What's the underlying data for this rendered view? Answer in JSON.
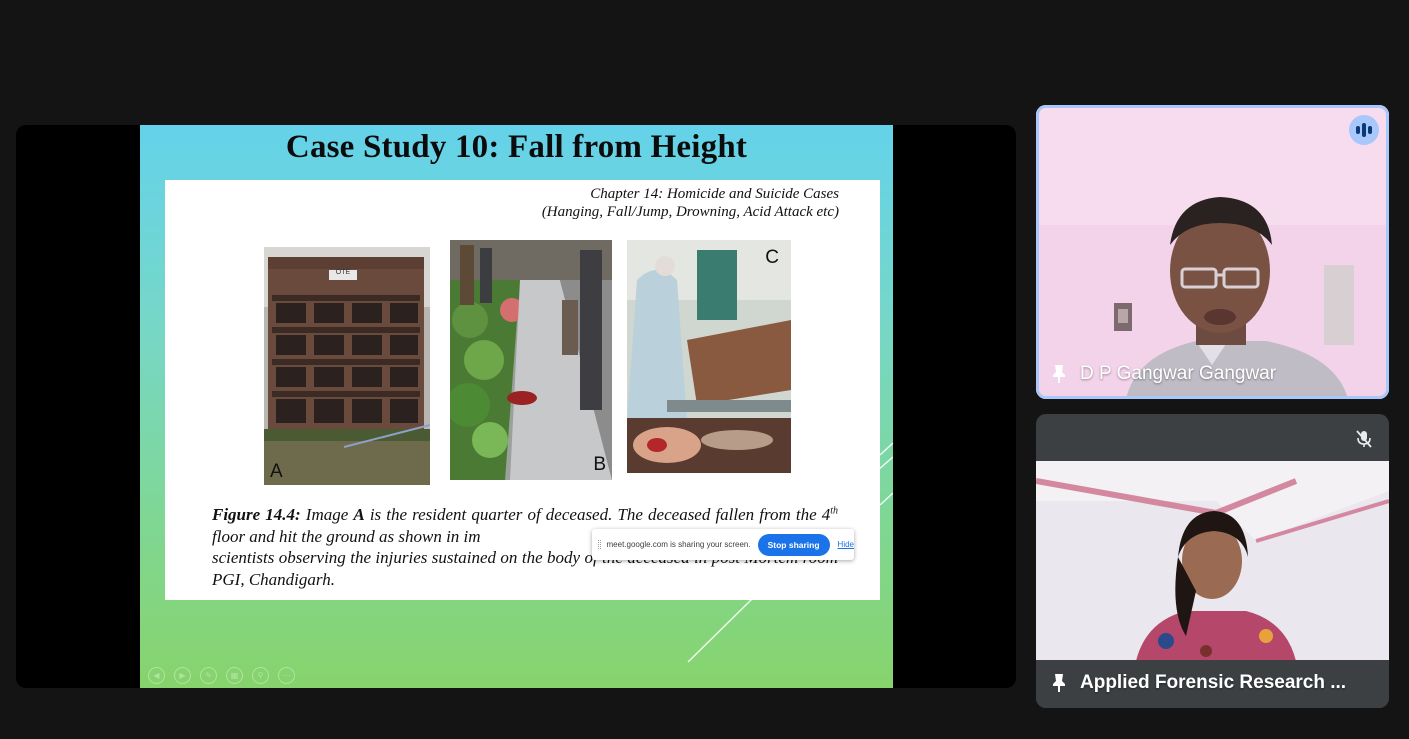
{
  "slide": {
    "title": "Case Study 10: Fall from Height",
    "chapter_line1": "Chapter 14: Homicide and Suicide Cases",
    "chapter_line2": "(Hanging, Fall/Jump, Drowning, Acid Attack etc)",
    "photo_labels": [
      "A",
      "B",
      "C"
    ],
    "photo_a_sign": "OTE",
    "caption": {
      "figure_label": "Figure 14.4:",
      "part1": " Image ",
      "image_a": "A",
      "part2": " is the resident quarter of deceased. The deceased fallen from the 4",
      "sup": "th",
      "part3": " floor and hit the ground as shown in im",
      "part4": "scientists observing the injuries sustained on the body of the deceased in post Mortem room PGI, Chandigarh."
    }
  },
  "share_bar": {
    "message": "meet.google.com is sharing your screen.",
    "stop_label": "Stop sharing",
    "hide_label": "Hide"
  },
  "participants": [
    {
      "name": "D P Gangwar Gangwar",
      "pinned": true,
      "speaking": true,
      "muted": false,
      "status_icon": "speaking-icon"
    },
    {
      "name": "Applied Forensic Research ...",
      "pinned": true,
      "speaking": false,
      "muted": true,
      "status_icon": "mic-off-icon"
    }
  ],
  "colors": {
    "background": "#141414",
    "active_speaker_border": "#a8c7fa",
    "stop_sharing": "#1a73e8",
    "tile_dark": "#3c4043"
  }
}
